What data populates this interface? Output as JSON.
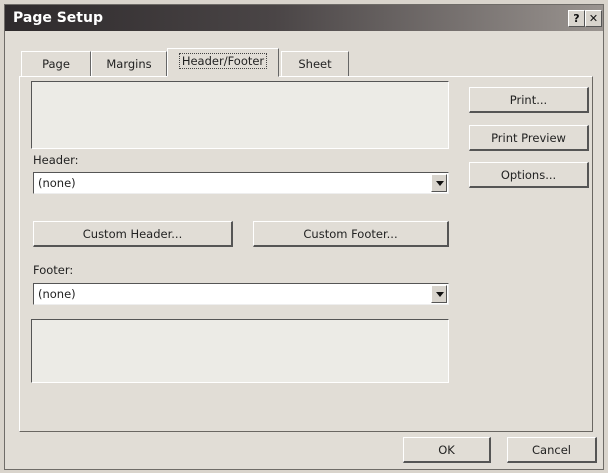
{
  "window": {
    "title": "Page Setup",
    "help_label": "?",
    "close_label": "✕"
  },
  "tabs": [
    {
      "label": "Page"
    },
    {
      "label": "Margins"
    },
    {
      "label": "Header/Footer",
      "active": true
    },
    {
      "label": "Sheet"
    }
  ],
  "header": {
    "label": "Header:",
    "value": "(none)"
  },
  "footer": {
    "label": "Footer:",
    "value": "(none)"
  },
  "buttons": {
    "print": "Print...",
    "print_preview": "Print Preview",
    "options": "Options...",
    "custom_header": "Custom Header...",
    "custom_footer": "Custom Footer...",
    "ok": "OK",
    "cancel": "Cancel"
  }
}
